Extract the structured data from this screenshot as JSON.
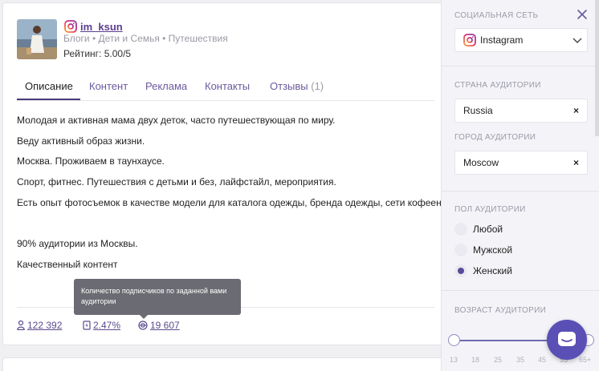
{
  "profile": {
    "username": "im_ksun",
    "categories": "Блоги • Дети и Семья • Путешествия",
    "rating": "Рейтинг: 5.00/5"
  },
  "tabs": [
    {
      "label": "Описание",
      "active": true
    },
    {
      "label": "Контент"
    },
    {
      "label": "Реклама"
    },
    {
      "label": "Контакты"
    },
    {
      "label": "Отзывы",
      "count": "(1)"
    }
  ],
  "description": [
    "Молодая и активная мама двух деток, часто путешествующая по миру.",
    "Веду активный образ жизни.",
    "Москва. Проживаем в таунхаусе.",
    "Спорт, фитнес. Путешествия с детьми  и без, лайфстайл, мероприятия.",
    "Есть опыт фотосъемок в качестве модели для каталога одежды, бренда одежды, сети кофеен.",
    "90% аудитории из Москвы.",
    "Качественный контент"
  ],
  "stats": {
    "followers": "122 392",
    "engagement": "2.47%",
    "audience": "19 607"
  },
  "tooltip": "Количество подписчиков по заданной вами аудитории",
  "sidebar": {
    "social_label": "СОЦИАЛЬНАЯ СЕТЬ",
    "social_value": "Instagram",
    "country_label": "СТРАНА АУДИТОРИИ",
    "country_value": "Russia",
    "city_label": "ГОРОД АУДИТОРИИ",
    "city_value": "Moscow",
    "clear_symbol": "×",
    "gender_label": "ПОЛ АУДИТОРИИ",
    "gender_options": [
      "Любой",
      "Мужской",
      "Женский"
    ],
    "gender_selected": "Женский",
    "age_label": "ВОЗРАСТ АУДИТОРИИ",
    "age_ticks": [
      "13",
      "18",
      "25",
      "35",
      "45",
      "55",
      "65+"
    ]
  },
  "colors": {
    "accent": "#5a4fb5",
    "link": "#5b3d8f"
  }
}
